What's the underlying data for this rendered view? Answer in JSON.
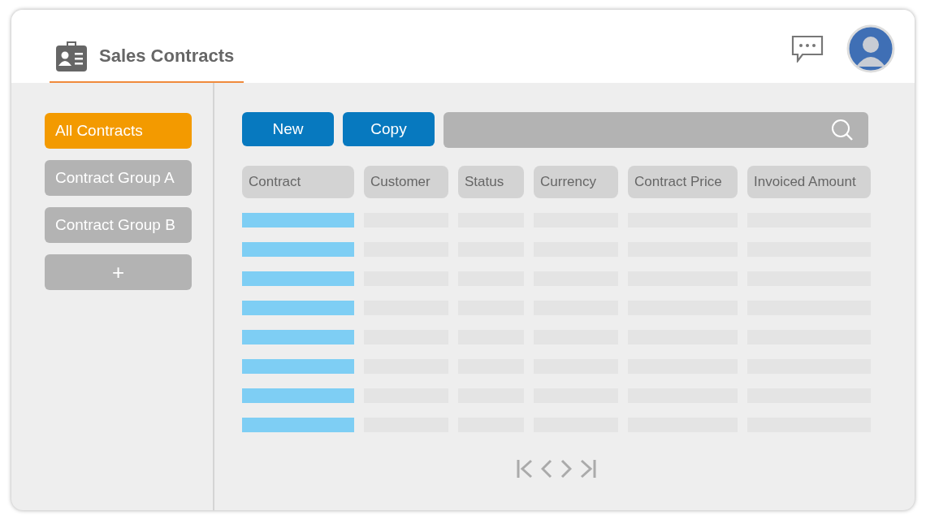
{
  "header": {
    "title": "Sales Contracts"
  },
  "sidebar": {
    "items": [
      {
        "label": "All Contracts",
        "selected": true
      },
      {
        "label": "Contract Group A",
        "selected": false
      },
      {
        "label": "Contract Group B",
        "selected": false
      }
    ],
    "add_button": "+"
  },
  "toolbar": {
    "buttons": [
      "New",
      "Copy"
    ]
  },
  "table": {
    "columns": [
      "Contract",
      "Customer",
      "Status",
      "Currency",
      "Contract Price",
      "Invoiced Amount"
    ],
    "rows": [
      {
        "kind": "skeleton"
      },
      {
        "kind": "skeleton"
      },
      {
        "kind": "skeleton"
      },
      {
        "kind": "skeleton"
      },
      {
        "kind": "skeleton"
      },
      {
        "kind": "skeleton"
      },
      {
        "kind": "skeleton"
      },
      {
        "kind": "skeleton"
      }
    ]
  }
}
